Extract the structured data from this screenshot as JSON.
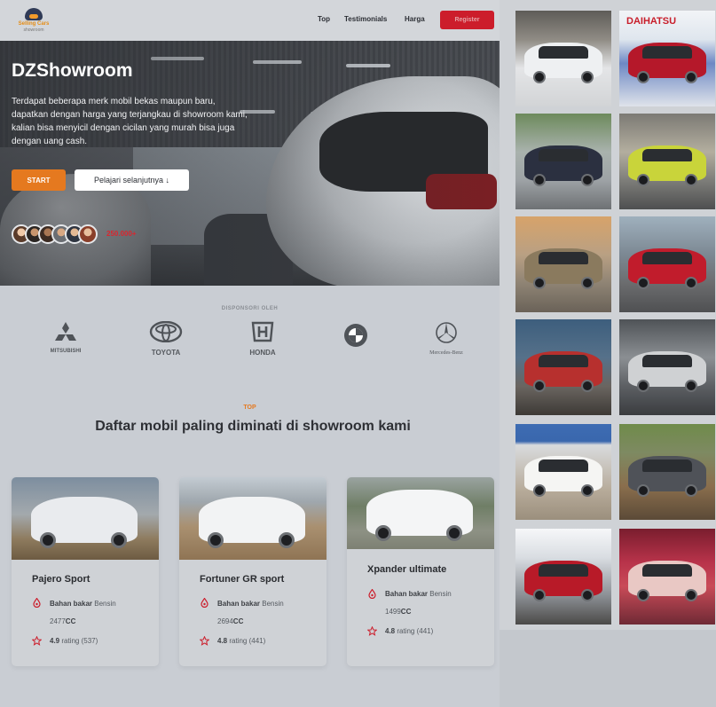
{
  "nav": {
    "logo_text": "Selling Cars",
    "logo_sub": "showroom",
    "links": [
      "Top",
      "Testimonials",
      "Harga"
    ],
    "register_label": "Register"
  },
  "hero": {
    "title": "DZShowroom",
    "description": "Terdapat beberapa merk mobil bekas maupun baru, dapatkan dengan harga yang terjangkau di showroom kami, kalian bisa menyicil dengan cicilan yang murah bisa juga dengan uang cash.",
    "start_label": "START",
    "more_label": "Pelajari selanjutnya ↓",
    "customers_count": "250.000+"
  },
  "sponsors": {
    "label": "DISPONSORI OLEH",
    "brands": [
      "MITSUBISHI",
      "TOYOTA",
      "HONDA",
      "BMW",
      "Mercedes-Benz"
    ]
  },
  "section": {
    "tag": "TOP",
    "title": "Daftar mobil paling diminati di showroom kami"
  },
  "cards": [
    {
      "name": "Pajero Sport",
      "fuel_label": "Bahan bakar",
      "fuel": "Bensin",
      "cc": "2477",
      "cc_unit": "CC",
      "rating": "4.9",
      "rating_text": "rating (537)",
      "color": "#e9ebee"
    },
    {
      "name": "Fortuner GR sport",
      "fuel_label": "Bahan bakar",
      "fuel": "Bensin",
      "cc": "2694",
      "cc_unit": "CC",
      "rating": "4.8",
      "rating_text": "rating (441)",
      "color": "#f2f3f4"
    },
    {
      "name": "Xpander ultimate",
      "fuel_label": "Bahan bakar",
      "fuel": "Bensin",
      "cc": "1499",
      "cc_unit": "CC",
      "rating": "4.8",
      "rating_text": "rating (441)",
      "color": "#f4f5f6"
    }
  ],
  "gallery": {
    "banner_text": "DAIHATSU",
    "car_colors": [
      "#eef0f2",
      "#b5182a",
      "#2b3040",
      "#c9d43a",
      "#8a7a5e",
      "#c11c2c",
      "#b7302e",
      "#cfd1d3",
      "#f5f5f3",
      "#4f5258",
      "#b81a28",
      "#e9c8c4"
    ]
  },
  "colors": {
    "accent": "#e5791f",
    "brand_red": "#cc1d2b"
  }
}
